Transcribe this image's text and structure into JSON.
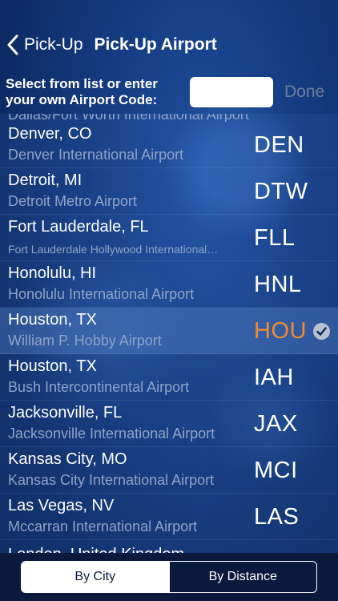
{
  "nav": {
    "back_label": "Pick-Up",
    "title": "Pick-Up Airport"
  },
  "code_entry": {
    "prompt": "Select from list or enter your own Airport Code:",
    "value": "",
    "done_label": "Done"
  },
  "list": {
    "partial_top": "Dallas/Fort Worth International Airport",
    "rows": [
      {
        "city": "Denver, CO",
        "airport": "Denver International Airport",
        "code": "DEN"
      },
      {
        "city": "Detroit, MI",
        "airport": "Detroit Metro Airport",
        "code": "DTW"
      },
      {
        "city": "Fort Lauderdale, FL",
        "airport": "Fort Lauderdale Hollywood International…",
        "code": "FLL"
      },
      {
        "city": "Honolulu, HI",
        "airport": "Honolulu International Airport",
        "code": "HNL"
      },
      {
        "city": "Houston, TX",
        "airport": "William P. Hobby Airport",
        "code": "HOU",
        "selected": true
      },
      {
        "city": "Houston, TX",
        "airport": "Bush Intercontinental Airport",
        "code": "IAH"
      },
      {
        "city": "Jacksonville, FL",
        "airport": "Jacksonville International Airport",
        "code": "JAX"
      },
      {
        "city": "Kansas City, MO",
        "airport": "Kansas City International Airport",
        "code": "MCI"
      },
      {
        "city": "Las Vegas, NV",
        "airport": "Mccarran International Airport",
        "code": "LAS"
      }
    ],
    "partial_bottom": "London, United Kingdom"
  },
  "segments": {
    "by_city": "By City",
    "by_distance": "By Distance",
    "active": "by_city"
  },
  "colors": {
    "selected_code": "#f28a2e",
    "background": "#143a7e"
  }
}
